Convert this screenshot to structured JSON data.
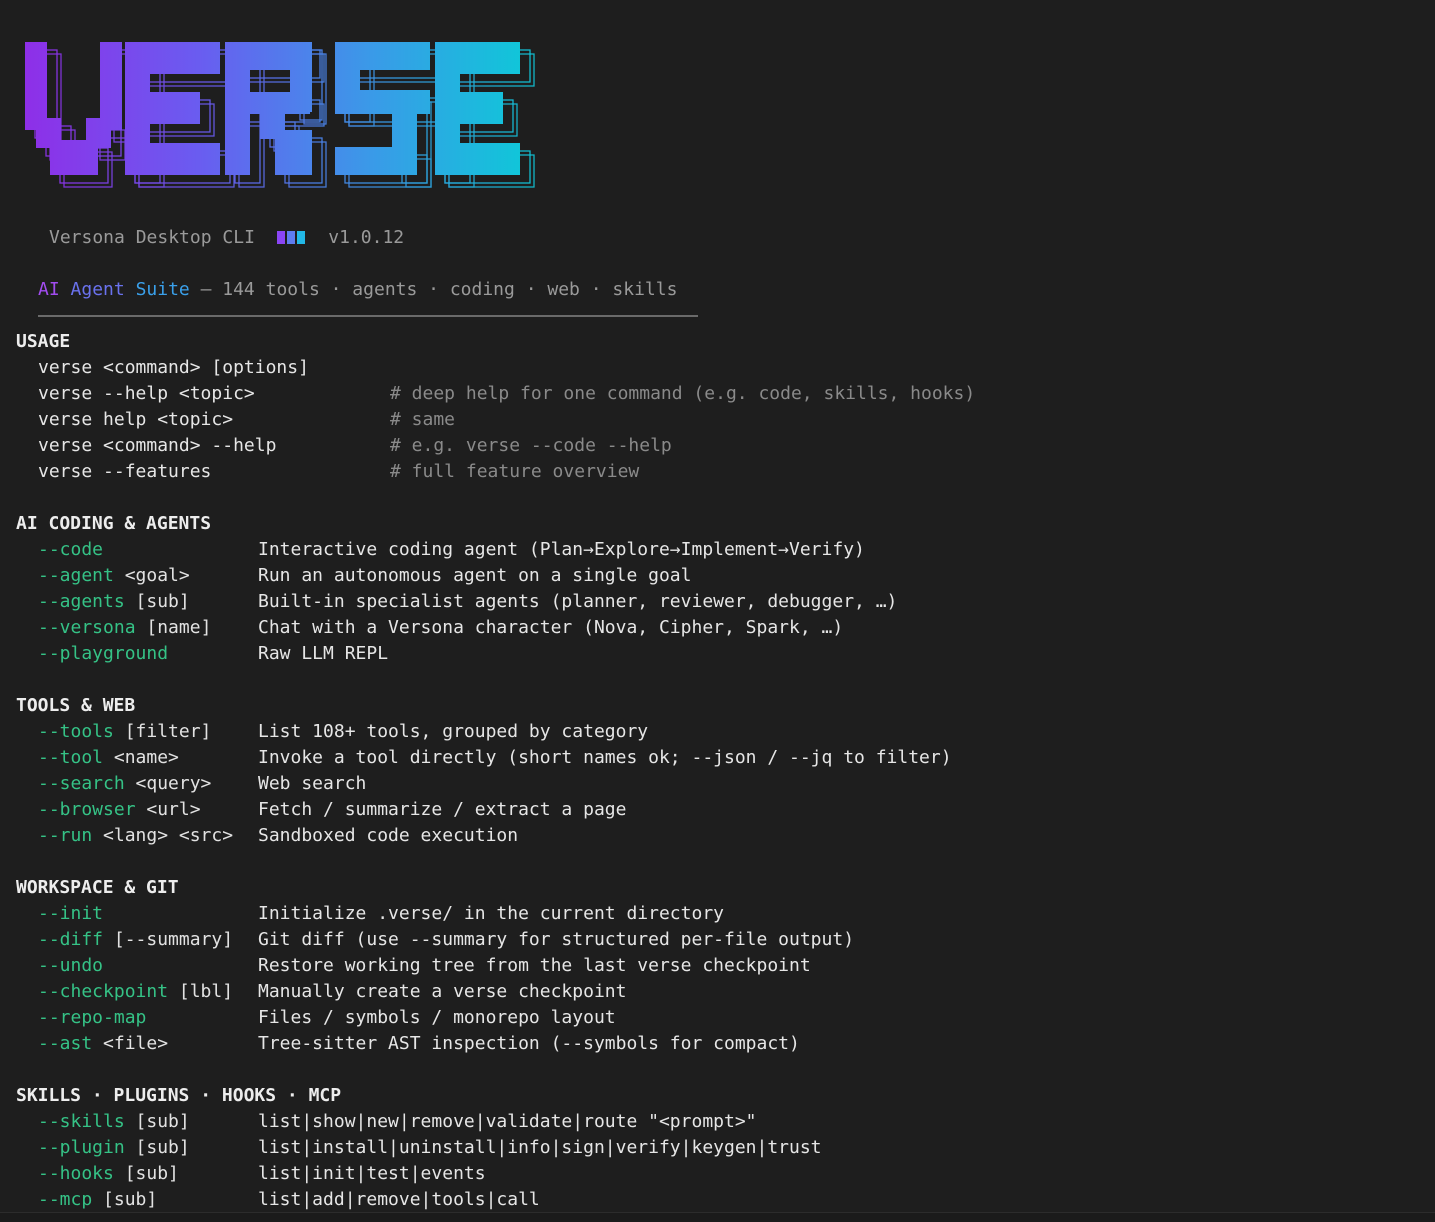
{
  "logo": {
    "text": "VERSE",
    "gradient_colors": [
      "#8e2fe8",
      "#6a5cf0",
      "#3a9ae8",
      "#11c5d9"
    ]
  },
  "banner": {
    "product": "Versona Desktop CLI",
    "version": "v1.0.12",
    "badge_colors": [
      "#8b45f5",
      "#5e7cf0",
      "#22b8e6"
    ]
  },
  "tagline": {
    "word1": "AI",
    "word2": "Agent",
    "word3": "Suite",
    "rest": " — 144 tools · agents · coding · web · skills"
  },
  "sections": {
    "usage": {
      "title": "USAGE",
      "lines": [
        {
          "cmd": "verse <command> [options]",
          "comment": ""
        },
        {
          "cmd": "verse --help <topic>",
          "comment": "# deep help for one command (e.g. code, skills, hooks)"
        },
        {
          "cmd": "verse help <topic>",
          "comment": "# same"
        },
        {
          "cmd": "verse <command> --help",
          "comment": "# e.g. verse --code --help"
        },
        {
          "cmd": "verse --features",
          "comment": "# full feature overview"
        }
      ]
    },
    "ai": {
      "title": "AI CODING & AGENTS",
      "rows": [
        {
          "flag": "--code",
          "arg": "",
          "desc": "Interactive coding agent (Plan→Explore→Implement→Verify)"
        },
        {
          "flag": "--agent",
          "arg": " <goal>",
          "desc": "Run an autonomous agent on a single goal"
        },
        {
          "flag": "--agents",
          "arg": " [sub]",
          "desc": "Built-in specialist agents (planner, reviewer, debugger, …)"
        },
        {
          "flag": "--versona",
          "arg": " [name]",
          "desc": "Chat with a Versona character (Nova, Cipher, Spark, …)"
        },
        {
          "flag": "--playground",
          "arg": "",
          "desc": "Raw LLM REPL"
        }
      ]
    },
    "tools": {
      "title": "TOOLS & WEB",
      "rows": [
        {
          "flag": "--tools",
          "arg": " [filter]",
          "desc": "List 108+ tools, grouped by category"
        },
        {
          "flag": "--tool",
          "arg": " <name>",
          "desc": "Invoke a tool directly (short names ok; --json / --jq to filter)"
        },
        {
          "flag": "--search",
          "arg": " <query>",
          "desc": "Web search"
        },
        {
          "flag": "--browser",
          "arg": " <url>",
          "desc": "Fetch / summarize / extract a page"
        },
        {
          "flag": "--run",
          "arg": " <lang> <src>",
          "desc": "Sandboxed code execution"
        }
      ]
    },
    "workspace": {
      "title": "WORKSPACE & GIT",
      "rows": [
        {
          "flag": "--init",
          "arg": "",
          "desc": "Initialize .verse/ in the current directory"
        },
        {
          "flag": "--diff",
          "arg": " [--summary]",
          "desc": "Git diff (use --summary for structured per-file output)"
        },
        {
          "flag": "--undo",
          "arg": "",
          "desc": "Restore working tree from the last verse checkpoint"
        },
        {
          "flag": "--checkpoint",
          "arg": " [lbl]",
          "desc": "Manually create a verse checkpoint"
        },
        {
          "flag": "--repo-map",
          "arg": "",
          "desc": "Files / symbols / monorepo layout"
        },
        {
          "flag": "--ast",
          "arg": " <file>",
          "desc": "Tree-sitter AST inspection (--symbols for compact)"
        }
      ]
    },
    "skills": {
      "title": "SKILLS · PLUGINS · HOOKS · MCP",
      "rows": [
        {
          "flag": "--skills",
          "arg": " [sub]",
          "desc": "list|show|new|remove|validate|route \"<prompt>\""
        },
        {
          "flag": "--plugin",
          "arg": " [sub]",
          "desc": "list|install|uninstall|info|sign|verify|keygen|trust"
        },
        {
          "flag": "--hooks",
          "arg": " [sub]",
          "desc": "list|init|test|events"
        },
        {
          "flag": "--mcp",
          "arg": " [sub]",
          "desc": "list|add|remove|tools|call"
        }
      ]
    }
  }
}
